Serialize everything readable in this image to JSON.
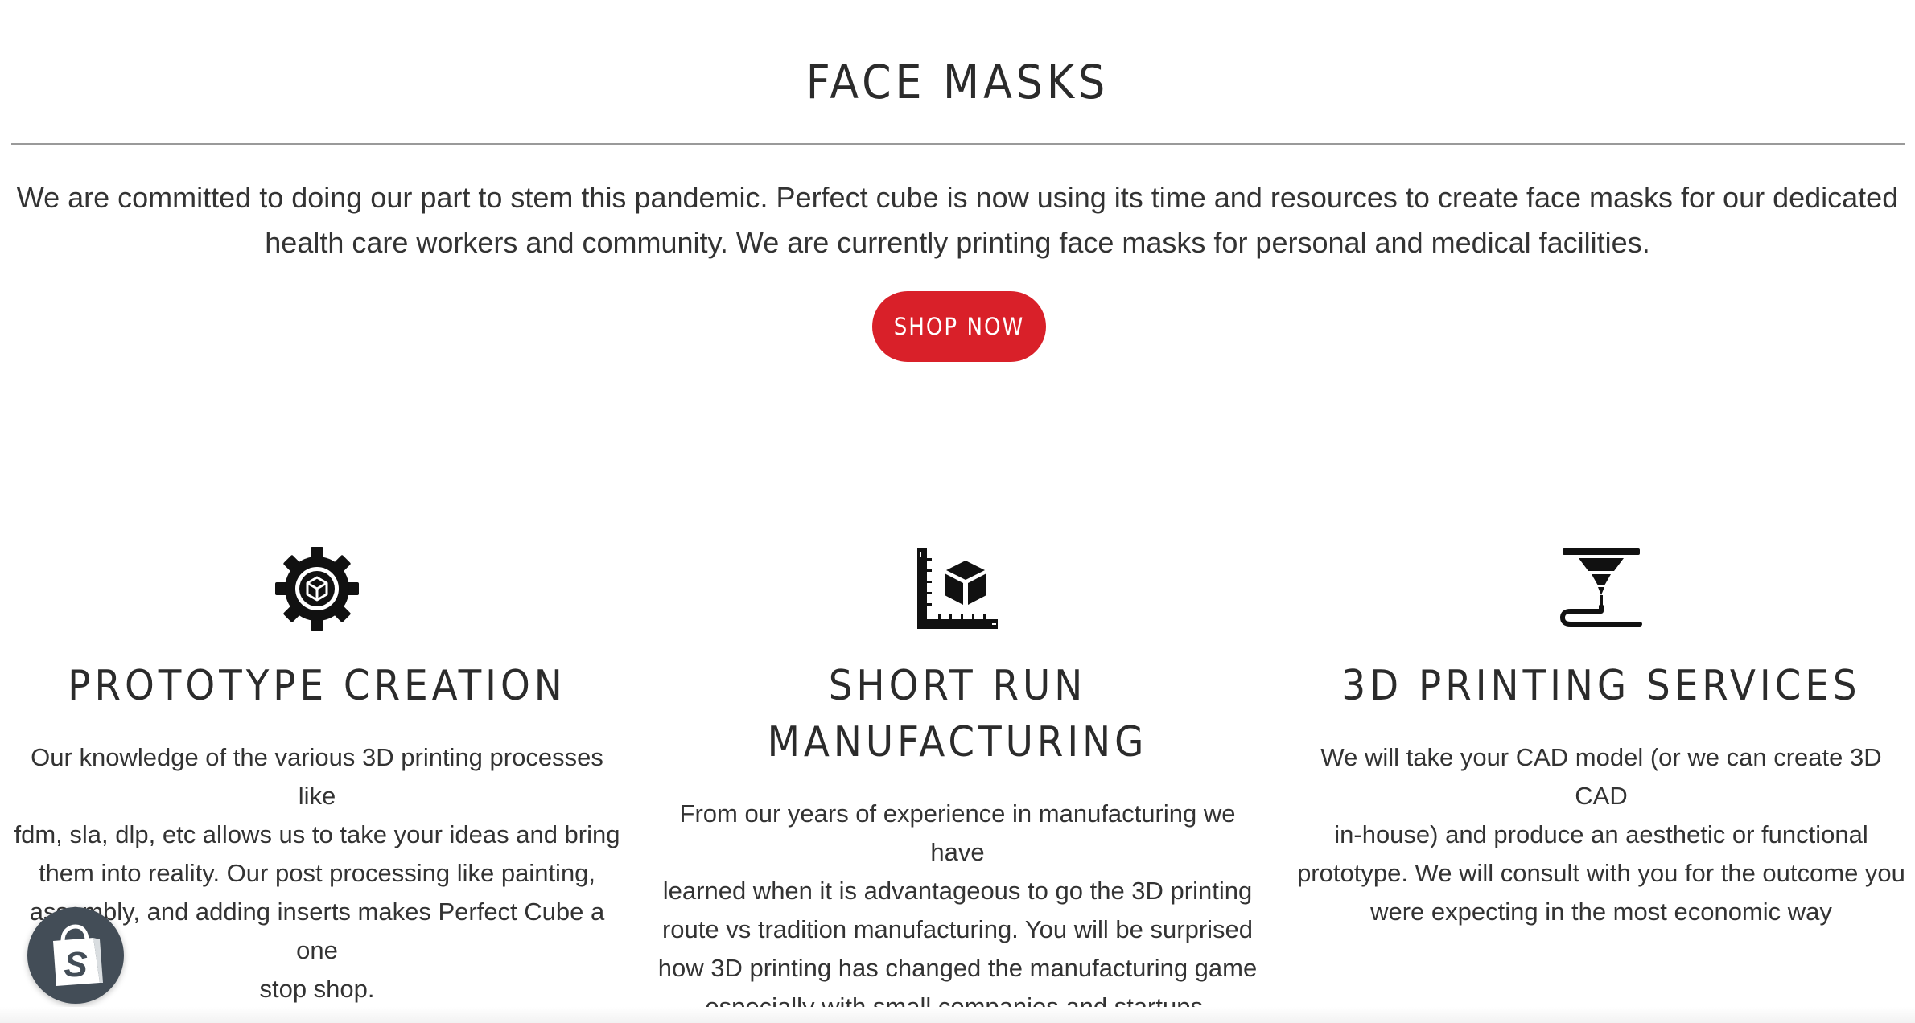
{
  "section": {
    "title": "FACE MASKS",
    "intro_line1": "We are committed to doing our part to stem this pandemic. Perfect cube is now using its time and resources to create face masks for our dedicated",
    "intro_line2": "health care workers and community. We are currently printing face masks  for personal and medical facilities.",
    "button_label": "SHOP NOW",
    "button_color": "#d92029"
  },
  "features": [
    {
      "icon": "gear-cube-icon",
      "title": "PROTOTYPE CREATION",
      "lines": [
        "Our knowledge of the various 3D printing processes like",
        "fdm, sla, dlp, etc allows us to take your ideas and bring",
        "them into reality. Our post processing like painting,",
        "assembly, and adding inserts makes Perfect Cube a one",
        "stop shop."
      ]
    },
    {
      "icon": "ruler-cube-icon",
      "title": "SHORT RUN MANUFACTURING",
      "lines": [
        "From our years of experience in manufacturing we have",
        "learned when it is advantageous to go the 3D printing",
        "route vs tradition manufacturing. You will be surprised",
        "how 3D printing has changed the manufacturing game",
        "especially with small companies and startups."
      ]
    },
    {
      "icon": "3d-printer-nozzle-icon",
      "title": "3D PRINTING SERVICES",
      "lines": [
        "We will take your CAD model (or we can create 3D CAD",
        "in-house) and produce an aesthetic or functional",
        "prototype. We will consult with you for the outcome you",
        "were expecting in the most economic way"
      ]
    }
  ],
  "badge": {
    "icon": "shopify-bag-icon",
    "color": "#434d57"
  }
}
